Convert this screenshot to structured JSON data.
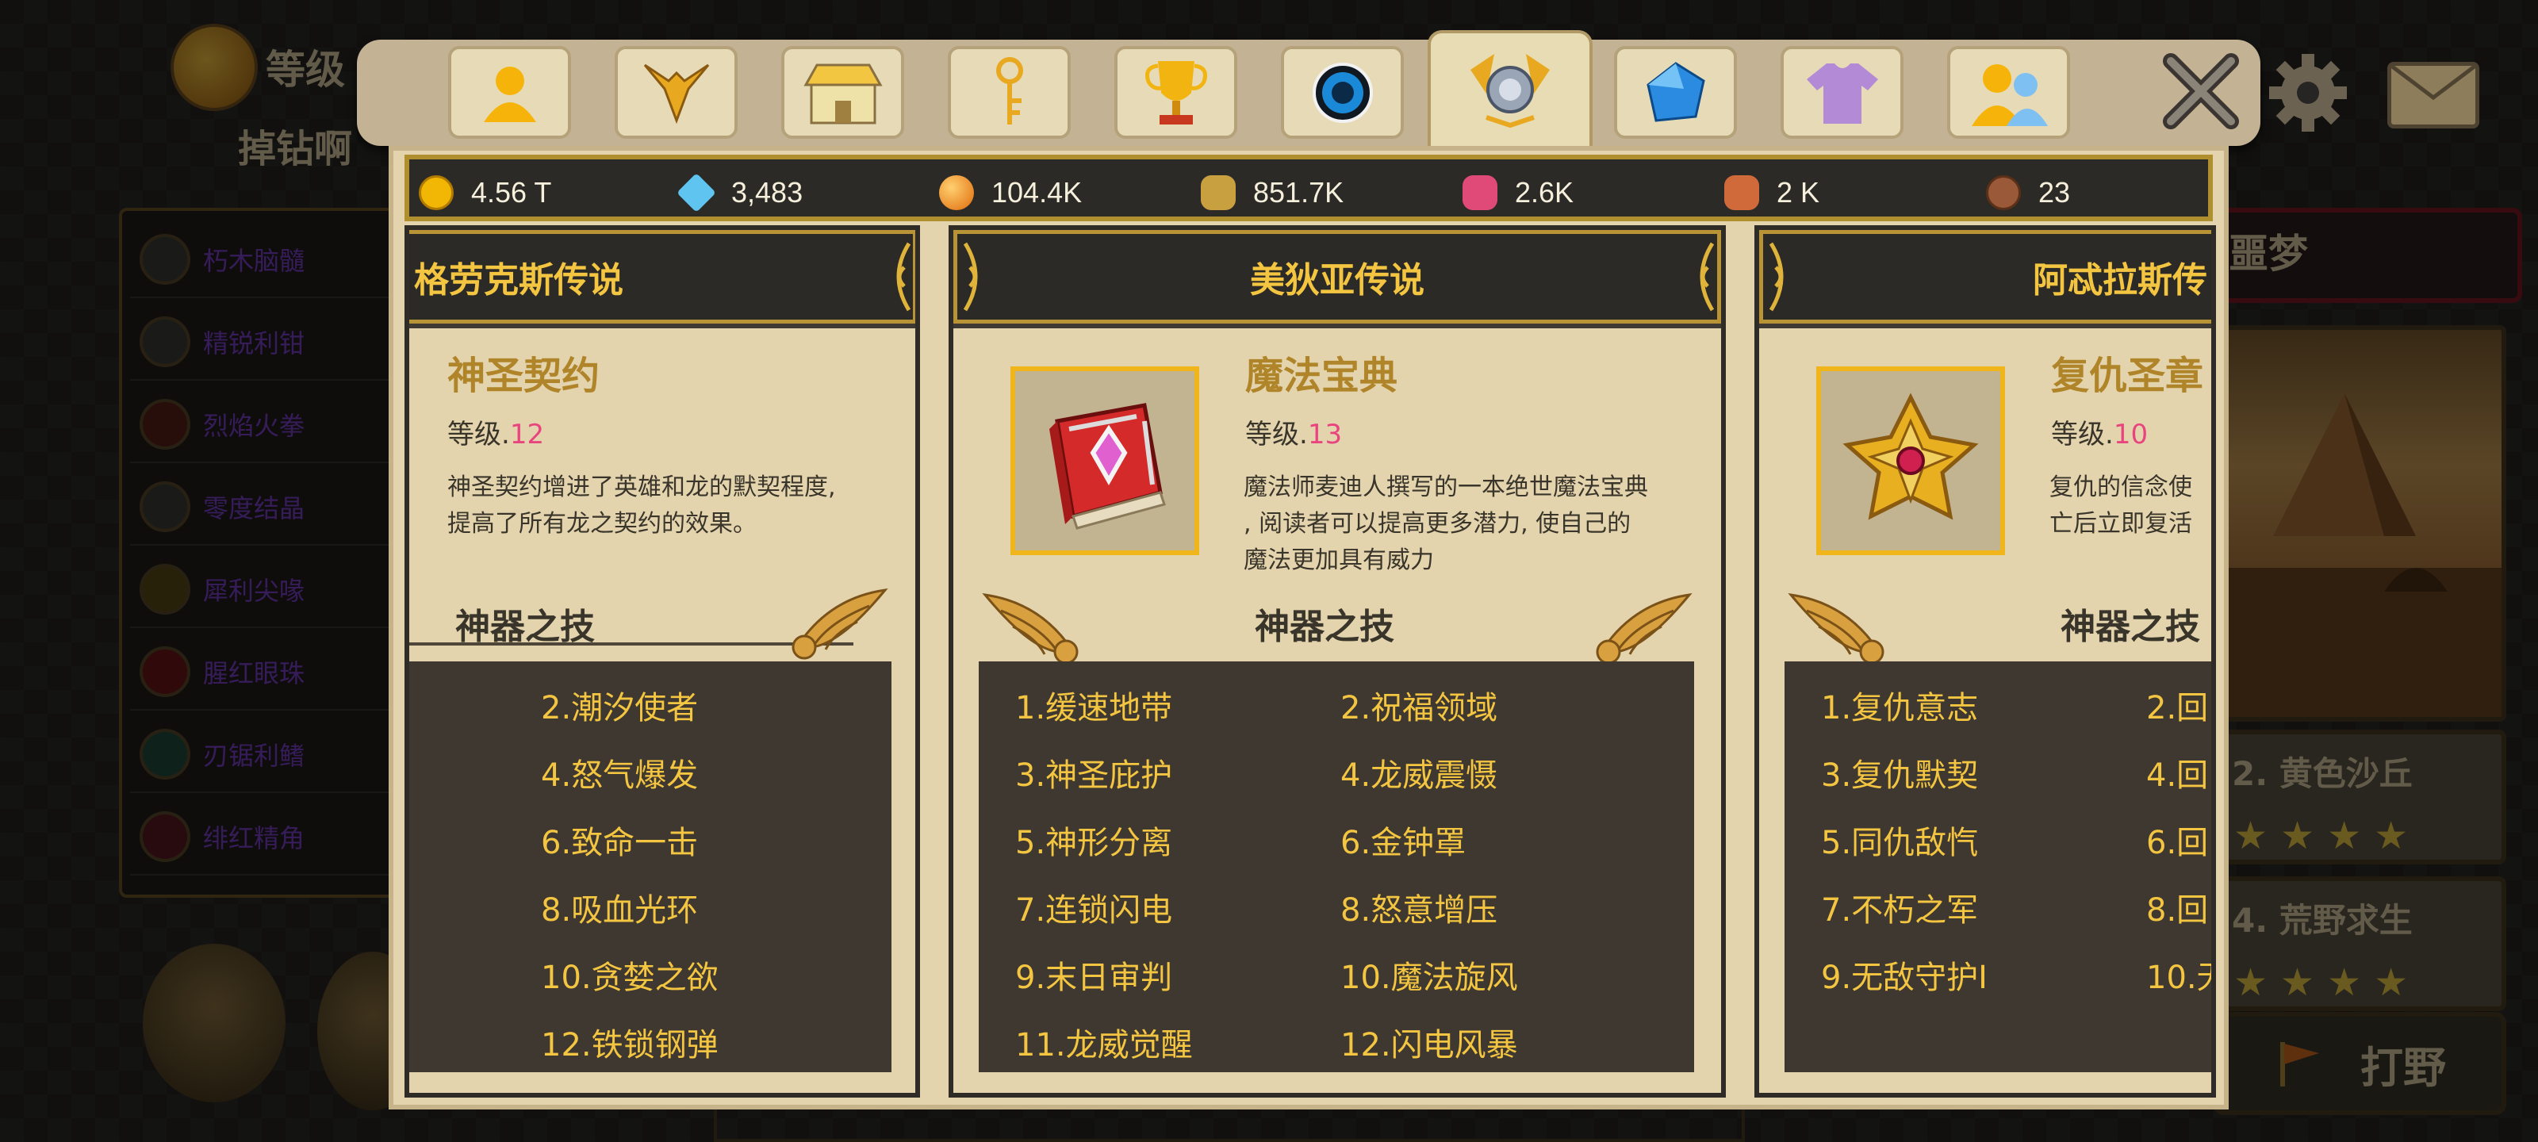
{
  "background": {
    "header": {
      "level_label": "等级",
      "player_name": "掉钻啊"
    },
    "list": [
      {
        "label": "朽木脑髓",
        "icon": "wood-icon"
      },
      {
        "label": "精锐利钳",
        "icon": "claw-icon"
      },
      {
        "label": "烈焰火拳",
        "icon": "fist-icon"
      },
      {
        "label": "零度结晶",
        "icon": "crystal-icon"
      },
      {
        "label": "犀利尖喙",
        "icon": "beak-icon"
      },
      {
        "label": "腥红眼珠",
        "icon": "eye-icon"
      },
      {
        "label": "刃锯利鳍",
        "icon": "fin-icon"
      },
      {
        "label": "绯红精角",
        "icon": "horn-icon"
      }
    ],
    "right": {
      "title": "噩梦",
      "cards": [
        {
          "label": "2. 黄色沙丘",
          "stars": 4
        },
        {
          "label": "4. 荒野求生",
          "stars": 4
        }
      ],
      "button_label": "打野"
    }
  },
  "tabs": [
    {
      "icon": "hero-icon",
      "active": false
    },
    {
      "icon": "dragon-icon",
      "active": false
    },
    {
      "icon": "shop-icon",
      "active": false
    },
    {
      "icon": "key-icon",
      "active": false
    },
    {
      "icon": "trophy-icon",
      "active": false
    },
    {
      "icon": "orb-icon",
      "active": false
    },
    {
      "icon": "artifact-icon",
      "active": true
    },
    {
      "icon": "gem-icon",
      "active": false
    },
    {
      "icon": "shirt-icon",
      "active": false
    },
    {
      "icon": "friends-icon",
      "active": false
    }
  ],
  "resources": [
    {
      "icon": "gold-coin-icon",
      "value": "4.56 T",
      "color": "#f2b705"
    },
    {
      "icon": "diamond-icon",
      "value": "3,483",
      "color": "#5fc4f0"
    },
    {
      "icon": "orange-orb-icon",
      "value": "104.4K",
      "color": "#f08a1a"
    },
    {
      "icon": "dragon-essence-icon",
      "value": "851.7K",
      "color": "#c9a040"
    },
    {
      "icon": "pink-dragon-icon",
      "value": "2.6K",
      "color": "#e04a78"
    },
    {
      "icon": "beast-icon",
      "value": "2 K",
      "color": "#d06a3a"
    },
    {
      "icon": "leather-icon",
      "value": "23",
      "color": "#9a5a3a"
    }
  ],
  "columns": [
    {
      "title": "格劳克斯传说",
      "item": {
        "name": "神圣契约",
        "level_label": "等级.",
        "level": "12",
        "desc": [
          "神圣契约增进了英雄和龙的默契程度,",
          "提高了所有龙之契约的效果。"
        ]
      },
      "skills_title": "神器之技",
      "skills": [
        "2.潮汐使者",
        "4.怒气爆发",
        "6.致命一击",
        "8.吸血光环",
        "10.贪婪之欲",
        "12.铁锁钢弹"
      ]
    },
    {
      "title": "美狄亚传说",
      "item": {
        "name": "魔法宝典",
        "level_label": "等级.",
        "level": "13",
        "desc": [
          "魔法师麦迪人撰写的一本绝世魔法宝典",
          ", 阅读者可以提高更多潜力, 使自己的",
          "魔法更加具有威力"
        ]
      },
      "skills_title": "神器之技",
      "skills": [
        "1.缓速地带",
        "2.祝福领域",
        "3.神圣庇护",
        "4.龙威震慑",
        "5.神形分离",
        "6.金钟罩",
        "7.连锁闪电",
        "8.怒意增压",
        "9.末日审判",
        "10.魔法旋风",
        "11.龙威觉醒",
        "12.闪电风暴"
      ]
    },
    {
      "title": "阿忒拉斯传",
      "item": {
        "name": "复仇圣章",
        "level_label": "等级.",
        "level": "10",
        "desc": [
          "复仇的信念使",
          "亡后立即复活"
        ]
      },
      "skills_title": "神器之技",
      "skills": [
        "1.复仇意志",
        "2.回",
        "3.复仇默契",
        "4.回",
        "5.同仇敌忾",
        "6.回",
        "7.不朽之军",
        "8.回",
        "9.无敌守护I",
        "10.无"
      ]
    }
  ]
}
